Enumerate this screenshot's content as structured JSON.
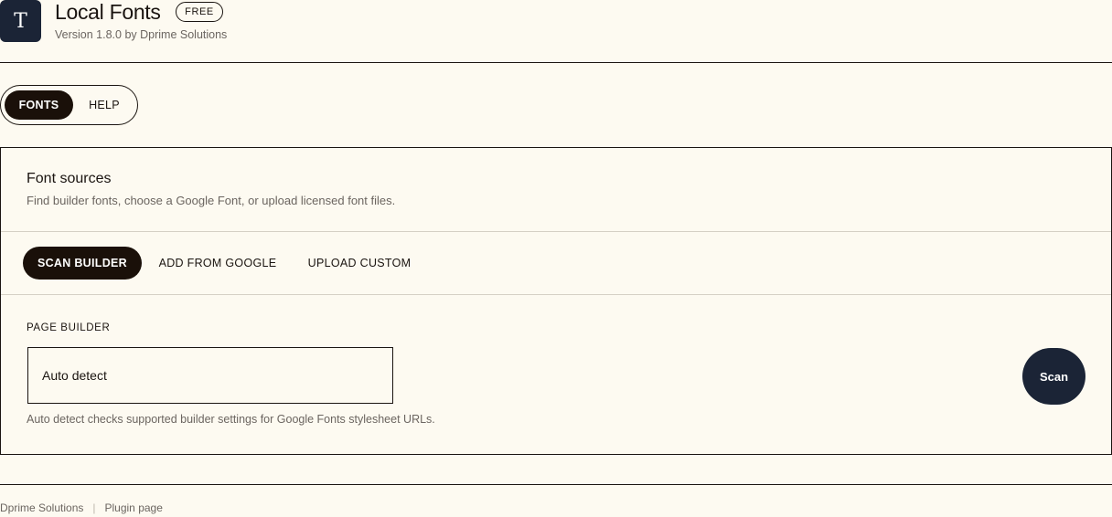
{
  "header": {
    "logo_letter": "T",
    "title": "Local Fonts",
    "badge": "FREE",
    "version": "Version 1.8.0 by Dprime Solutions"
  },
  "main_tabs": [
    {
      "label": "FONTS",
      "active": true
    },
    {
      "label": "HELP",
      "active": false
    }
  ],
  "panel": {
    "title": "Font sources",
    "description": "Find builder fonts, choose a Google Font, or upload licensed font files.",
    "tabs": [
      {
        "label": "SCAN BUILDER",
        "active": true
      },
      {
        "label": "ADD FROM GOOGLE",
        "active": false
      },
      {
        "label": "UPLOAD CUSTOM",
        "active": false
      }
    ],
    "field_label": "PAGE BUILDER",
    "select_value": "Auto detect",
    "help_text": "Auto detect checks supported builder settings for Google Fonts stylesheet URLs.",
    "scan_button": "Scan"
  },
  "footer": {
    "company": "Dprime Solutions",
    "separator": "|",
    "plugin_link": "Plugin page"
  },
  "colors": {
    "background": "#fdfaf1",
    "dark": "#1a1009",
    "navy": "#1b2436",
    "muted_text": "#6b6560"
  }
}
